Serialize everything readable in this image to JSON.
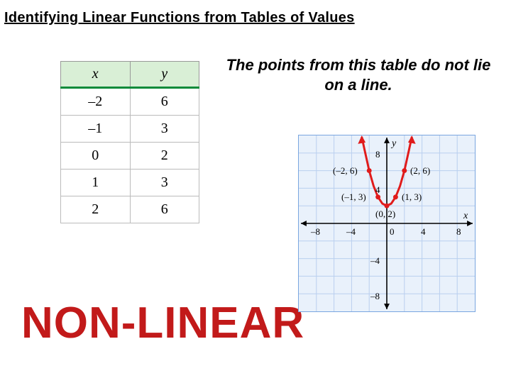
{
  "title": "Identifying Linear Functions from Tables of Values",
  "caption": "The points from this table do not lie on a line.",
  "nonlinear_label": "NON-LINEAR",
  "table": {
    "headers": {
      "x": "x",
      "y": "y"
    },
    "rows": [
      {
        "x": "–2",
        "y": "6"
      },
      {
        "x": "–1",
        "y": "3"
      },
      {
        "x": "0",
        "y": "2"
      },
      {
        "x": "1",
        "y": "3"
      },
      {
        "x": "2",
        "y": "6"
      }
    ]
  },
  "chart_data": {
    "type": "scatter",
    "title": "",
    "xlabel": "x",
    "ylabel": "y",
    "xlim": [
      -10,
      10
    ],
    "ylim": [
      -10,
      10
    ],
    "xticks": [
      -8,
      -4,
      0,
      4,
      8
    ],
    "yticks": [
      -8,
      -4,
      0,
      4,
      8
    ],
    "grid": true,
    "series": [
      {
        "name": "parabola",
        "type": "line",
        "color": "#e01b1b",
        "x": [
          -3,
          -2.5,
          -2,
          -1.5,
          -1,
          -0.5,
          0,
          0.5,
          1,
          1.5,
          2,
          2.5,
          3
        ],
        "y": [
          11,
          8.25,
          6,
          4.25,
          3,
          2.25,
          2,
          2.25,
          3,
          4.25,
          6,
          8.25,
          11
        ]
      },
      {
        "name": "points",
        "type": "scatter",
        "color": "#e01b1b",
        "x": [
          -2,
          -1,
          0,
          1,
          2
        ],
        "y": [
          6,
          3,
          2,
          3,
          6
        ]
      }
    ],
    "annotations": [
      {
        "text": "(–2, 6)",
        "x": -2,
        "y": 6,
        "anchor": "right"
      },
      {
        "text": "(–1, 3)",
        "x": -1,
        "y": 3,
        "anchor": "right"
      },
      {
        "text": "(0, 2)",
        "x": 0,
        "y": 2,
        "anchor": "below"
      },
      {
        "text": "(1, 3)",
        "x": 1,
        "y": 3,
        "anchor": "left"
      },
      {
        "text": "(2, 6)",
        "x": 2,
        "y": 6,
        "anchor": "left"
      }
    ]
  },
  "chart_ticklabels": {
    "x_neg8": "–8",
    "x_neg4": "–4",
    "x_0": "0",
    "x_4": "4",
    "x_8": "8",
    "y_neg8": "–8",
    "y_neg4": "–4",
    "y_4": "4",
    "y_8": "8"
  },
  "chart_pointlabels": {
    "p0": "(–2, 6)",
    "p1": "(–1, 3)",
    "p2": "(0, 2)",
    "p3": "(1, 3)",
    "p4": "(2, 6)"
  }
}
